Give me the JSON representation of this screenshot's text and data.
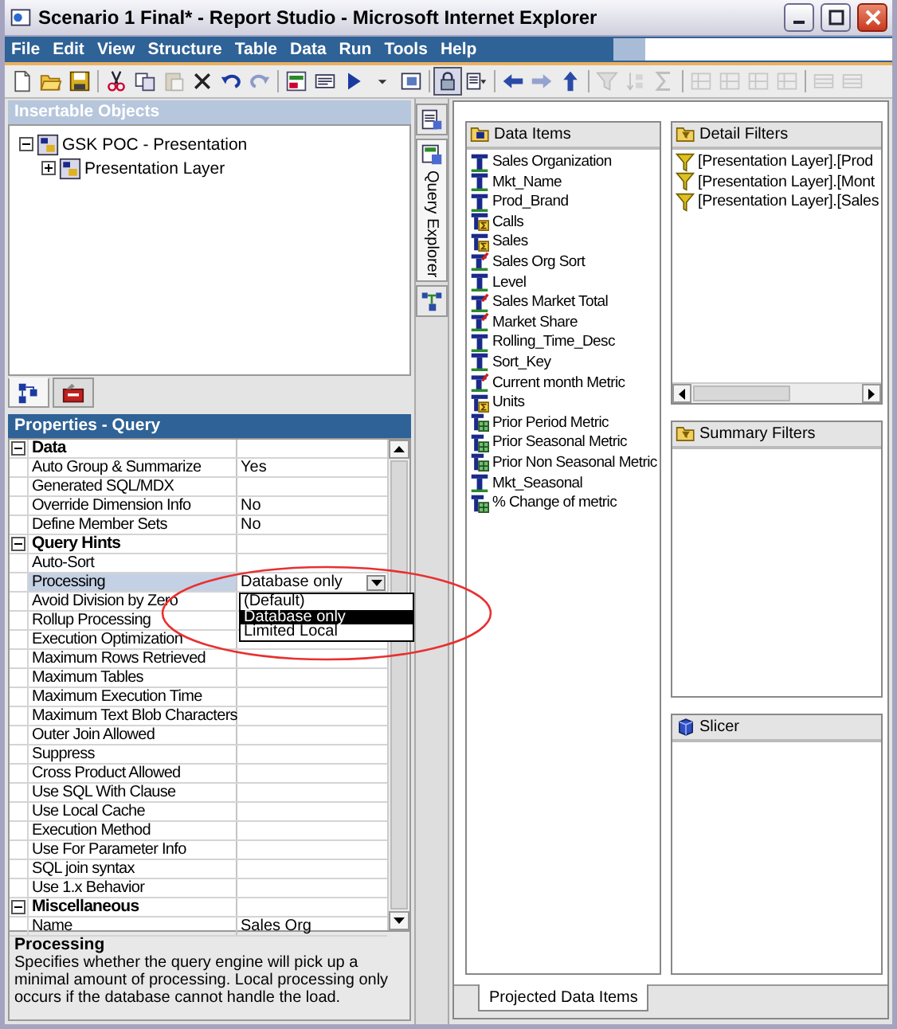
{
  "window": {
    "title": "Scenario 1 Final* - Report Studio - Microsoft Internet Explorer"
  },
  "menu": [
    "File",
    "Edit",
    "View",
    "Structure",
    "Table",
    "Data",
    "Run",
    "Tools",
    "Help"
  ],
  "toolbar": [
    {
      "kind": "new",
      "disabled": false,
      "pressed": false
    },
    {
      "kind": "open",
      "disabled": false,
      "pressed": false
    },
    {
      "kind": "save",
      "disabled": false,
      "pressed": false
    },
    {
      "kind": "separator"
    },
    {
      "kind": "cut",
      "disabled": false,
      "pressed": false
    },
    {
      "kind": "copy",
      "disabled": false,
      "pressed": false
    },
    {
      "kind": "paste",
      "disabled": true,
      "pressed": false
    },
    {
      "kind": "delete",
      "disabled": false,
      "pressed": false
    },
    {
      "kind": "undo",
      "disabled": false,
      "pressed": false
    },
    {
      "kind": "redo",
      "disabled": true,
      "pressed": false
    },
    {
      "kind": "separator"
    },
    {
      "kind": "report",
      "disabled": false,
      "pressed": false
    },
    {
      "kind": "xml",
      "disabled": false,
      "pressed": false
    },
    {
      "kind": "run",
      "disabled": false,
      "pressed": false
    },
    {
      "kind": "caret",
      "disabled": false,
      "pressed": false
    },
    {
      "kind": "view",
      "disabled": false,
      "pressed": false
    },
    {
      "kind": "separator"
    },
    {
      "kind": "lock",
      "disabled": false,
      "pressed": true
    },
    {
      "kind": "pages",
      "disabled": false,
      "pressed": false
    },
    {
      "kind": "separator"
    },
    {
      "kind": "back",
      "disabled": false,
      "pressed": false
    },
    {
      "kind": "forward",
      "disabled": true,
      "pressed": false
    },
    {
      "kind": "up",
      "disabled": false,
      "pressed": false
    },
    {
      "kind": "separator"
    },
    {
      "kind": "filter",
      "disabled": true,
      "pressed": false
    },
    {
      "kind": "sort",
      "disabled": true,
      "pressed": false
    },
    {
      "kind": "sum",
      "disabled": true,
      "pressed": false
    },
    {
      "kind": "separator"
    },
    {
      "kind": "layout",
      "disabled": true,
      "pressed": false
    },
    {
      "kind": "layout",
      "disabled": true,
      "pressed": false
    },
    {
      "kind": "layout",
      "disabled": true,
      "pressed": false
    },
    {
      "kind": "layout",
      "disabled": true,
      "pressed": false
    },
    {
      "kind": "separator"
    },
    {
      "kind": "rows",
      "disabled": true,
      "pressed": false
    },
    {
      "kind": "rows",
      "disabled": true,
      "pressed": false
    }
  ],
  "insertable_objects": {
    "title": "Insertable Objects",
    "tree": [
      {
        "label": "GSK POC - Presentation",
        "expanded": true,
        "children": [
          {
            "label": "Presentation Layer",
            "expanded": false
          }
        ]
      }
    ],
    "tabs": [
      {
        "kind": "source",
        "selected": true
      },
      {
        "kind": "toolbox",
        "selected": false
      }
    ]
  },
  "properties": {
    "title": "Properties - Query",
    "rows": [
      {
        "kind": "group",
        "label": "Data",
        "expanded": true
      },
      {
        "kind": "property",
        "label": "Auto Group & Summarize",
        "value": "Yes",
        "selected": false
      },
      {
        "kind": "property",
        "label": "Generated SQL/MDX",
        "selected": false
      },
      {
        "kind": "property",
        "label": "Override Dimension Info",
        "value": "No",
        "selected": false
      },
      {
        "kind": "property",
        "label": "Define Member Sets",
        "value": "No",
        "selected": false
      },
      {
        "kind": "group",
        "label": "Query Hints",
        "expanded": true
      },
      {
        "kind": "property",
        "label": "Auto-Sort",
        "selected": false
      },
      {
        "kind": "property",
        "label": "Processing",
        "value": "Database only",
        "selected": true,
        "dropdown": {
          "options": [
            {
              "label": "(Default)",
              "selected": false
            },
            {
              "label": "Database only",
              "selected": true
            },
            {
              "label": "Limited Local",
              "selected": false
            }
          ]
        }
      },
      {
        "kind": "property",
        "label": "Avoid Division by Zero",
        "selected": false
      },
      {
        "kind": "property",
        "label": "Rollup Processing",
        "selected": false
      },
      {
        "kind": "property",
        "label": "Execution Optimization",
        "selected": false
      },
      {
        "kind": "property",
        "label": "Maximum Rows Retrieved",
        "selected": false
      },
      {
        "kind": "property",
        "label": "Maximum Tables",
        "selected": false
      },
      {
        "kind": "property",
        "label": "Maximum Execution Time",
        "selected": false
      },
      {
        "kind": "property",
        "label": "Maximum Text Blob Characters",
        "selected": false
      },
      {
        "kind": "property",
        "label": "Outer Join Allowed",
        "selected": false
      },
      {
        "kind": "property",
        "label": "Suppress",
        "selected": false
      },
      {
        "kind": "property",
        "label": "Cross Product Allowed",
        "selected": false
      },
      {
        "kind": "property",
        "label": "Use SQL With Clause",
        "selected": false
      },
      {
        "kind": "property",
        "label": "Use Local Cache",
        "selected": false
      },
      {
        "kind": "property",
        "label": "Execution Method",
        "selected": false
      },
      {
        "kind": "property",
        "label": "Use For Parameter Info",
        "selected": false
      },
      {
        "kind": "property",
        "label": "SQL join syntax",
        "selected": false
      },
      {
        "kind": "property",
        "label": "Use 1.x Behavior",
        "selected": false
      },
      {
        "kind": "group",
        "label": "Miscellaneous",
        "expanded": true
      },
      {
        "kind": "property",
        "label": "Name",
        "value": "Sales Org",
        "selected": false
      }
    ],
    "description": {
      "title": "Processing",
      "text": "Specifies whether the query engine will pick up a minimal amount of processing. Local processing only occurs if the database cannot handle the load."
    }
  },
  "side_tabs": [
    {
      "kind": "page",
      "selected": false
    },
    {
      "kind": "query",
      "label": "Query Explorer",
      "selected": true
    },
    {
      "kind": "hierarchy",
      "selected": false
    }
  ],
  "data_items": {
    "title": "Data Items",
    "items": [
      {
        "label": "Sales Organization",
        "kind": "column"
      },
      {
        "label": "Mkt_Name",
        "kind": "column"
      },
      {
        "label": "Prod_Brand",
        "kind": "column"
      },
      {
        "label": "Calls",
        "kind": "measure"
      },
      {
        "label": "Sales",
        "kind": "measure"
      },
      {
        "label": "Sales Org Sort",
        "kind": "calculated"
      },
      {
        "label": "Level",
        "kind": "column"
      },
      {
        "label": "Sales Market Total",
        "kind": "calculated"
      },
      {
        "label": "Market Share",
        "kind": "calculated"
      },
      {
        "label": "Rolling_Time_Desc",
        "kind": "column"
      },
      {
        "label": "Sort_Key",
        "kind": "column"
      },
      {
        "label": "Current month Metric",
        "kind": "calculated"
      },
      {
        "label": "Units",
        "kind": "measure"
      },
      {
        "label": "Prior Period Metric",
        "kind": "table"
      },
      {
        "label": "Prior Seasonal Metric",
        "kind": "table"
      },
      {
        "label": "Prior Non Seasonal Metric",
        "kind": "table"
      },
      {
        "label": "Mkt_Seasonal",
        "kind": "column"
      },
      {
        "label": "% Change of metric",
        "kind": "table"
      }
    ]
  },
  "detail_filters": {
    "title": "Detail Filters",
    "items": [
      "[Presentation Layer].[Prod",
      "[Presentation Layer].[Mont",
      "[Presentation Layer].[Sales"
    ]
  },
  "summary_filters": {
    "title": "Summary Filters"
  },
  "slicer": {
    "title": "Slicer"
  },
  "bottom_tabs": [
    {
      "label": "Projected Data Items",
      "selected": true
    }
  ]
}
